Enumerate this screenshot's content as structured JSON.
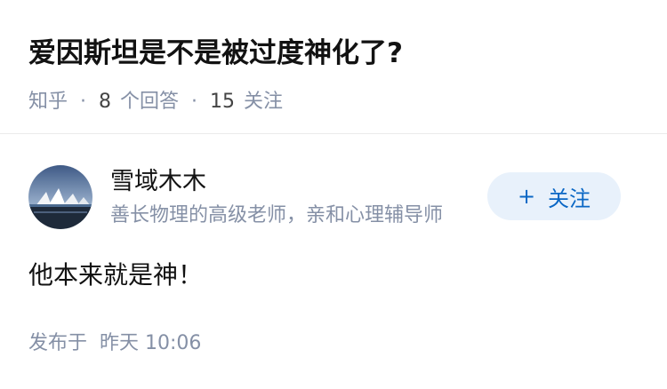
{
  "question": {
    "title": "爱因斯坦是不是被过度神化了?",
    "source": "知乎",
    "answer_count": "8",
    "answer_label": "个回答",
    "follower_count": "15",
    "follower_label": "关注"
  },
  "answer": {
    "author": {
      "name": "雪域木木",
      "bio": "善长物理的高级老师，亲和心理辅导师",
      "follow_label": "关注",
      "follow_icon": "plus-icon"
    },
    "content": "他本来就是神！",
    "publish_label": "发布于",
    "publish_time": "昨天 10:06"
  },
  "colors": {
    "title": "#121212",
    "meta": "#8590a6",
    "follow_bg": "#e8f1fb",
    "follow_text": "#0a67c5"
  }
}
